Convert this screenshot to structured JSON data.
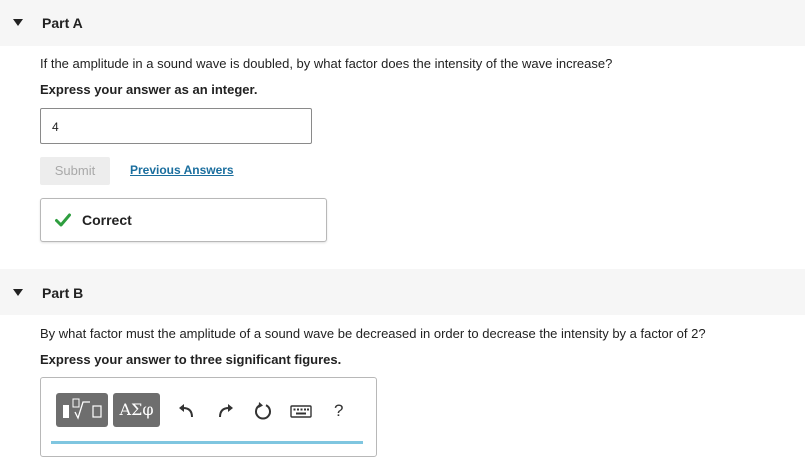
{
  "part_a": {
    "title": "Part A",
    "question": "If the amplitude in a sound wave is doubled, by what factor does the intensity of the wave increase?",
    "instruction": "Express your answer as an integer.",
    "answer_value": "4",
    "submit_label": "Submit",
    "previous_answers_label": "Previous Answers",
    "feedback_text": "Correct"
  },
  "part_b": {
    "title": "Part B",
    "question": "By what factor must the amplitude of a sound wave be decreased in order to decrease the intensity by a factor of 2?",
    "instruction": "Express your answer to three significant figures.",
    "toolbar": {
      "greek_label": "ΑΣφ",
      "help_label": "?"
    }
  },
  "colors": {
    "header_bg": "#f6f6f6",
    "link": "#1a6e9e",
    "check": "#2e9e3f",
    "toolbar_button": "#6e6e6e",
    "accent": "#7fc6e0"
  },
  "icons": [
    "collapse-caret-icon",
    "check-icon",
    "templates-icon",
    "undo-icon",
    "redo-icon",
    "reset-icon",
    "keyboard-icon"
  ]
}
